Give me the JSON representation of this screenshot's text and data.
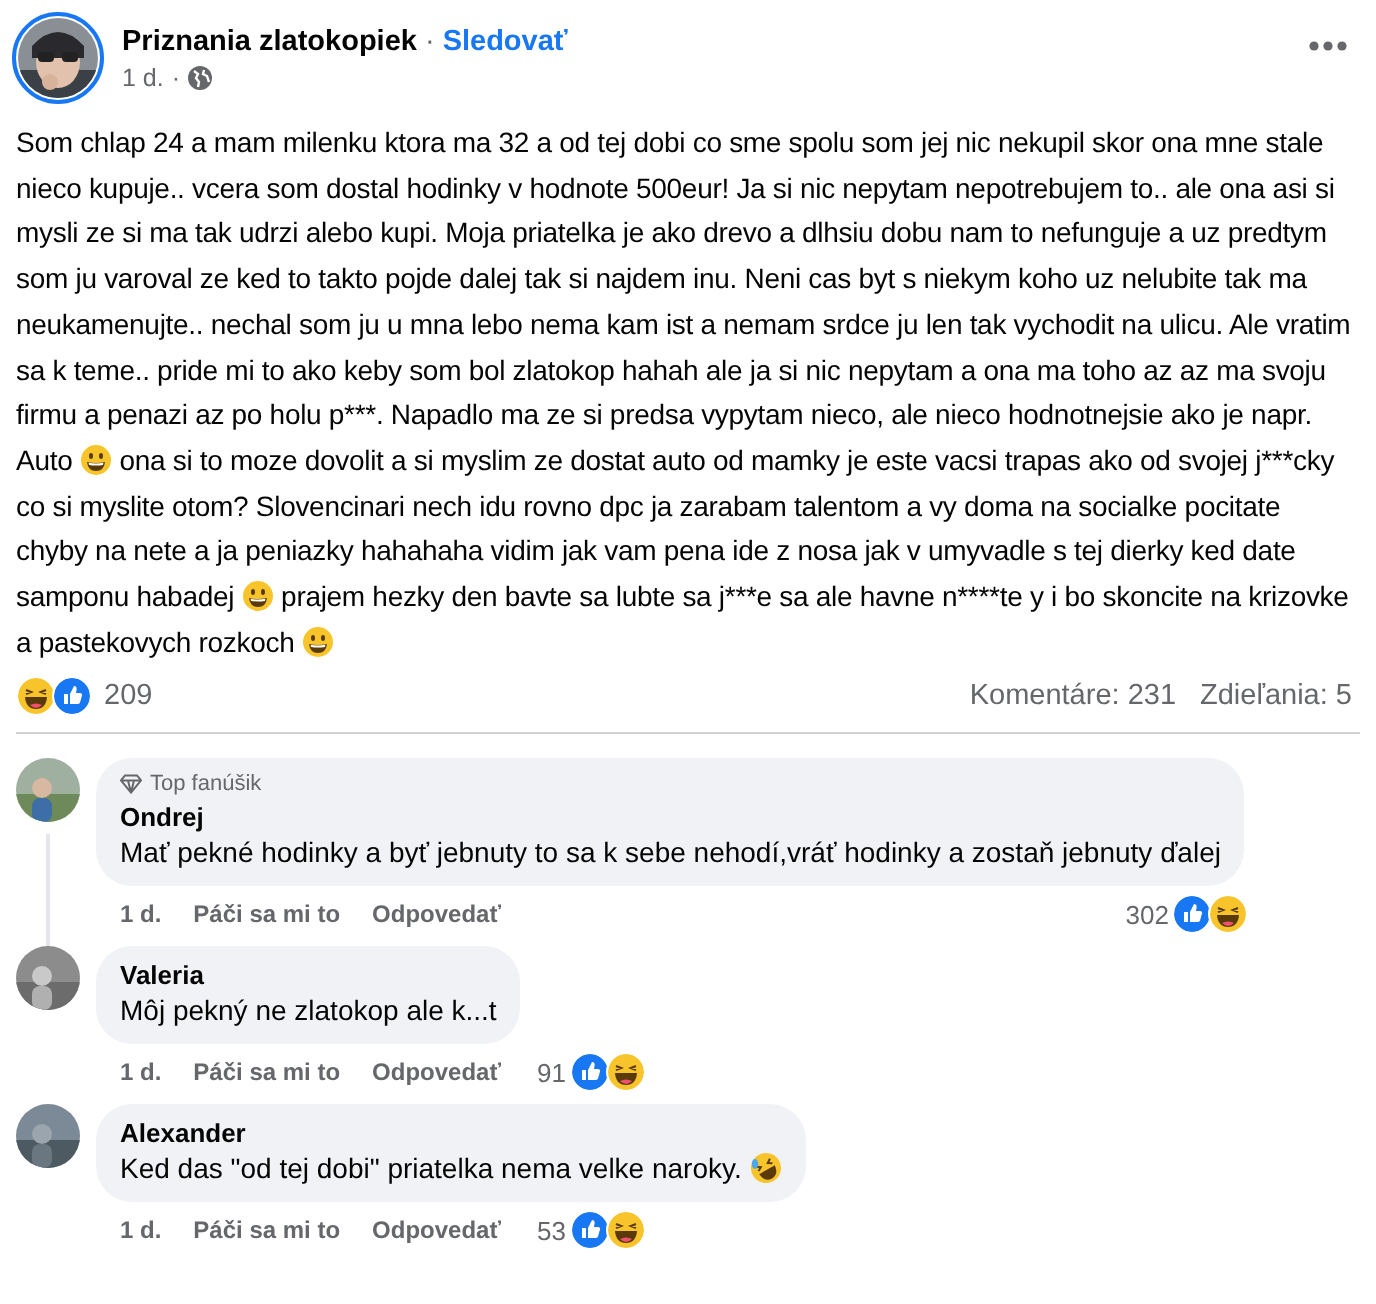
{
  "post": {
    "page_name": "Priznania zlatokopiek",
    "separator": "·",
    "follow": "Sledovať",
    "time": "1 d.",
    "time_separator": "·",
    "body": [
      {
        "kind": "text",
        "text": "Som chlap 24 a mam milenku ktora ma 32 a od tej dobi co sme spolu som jej nic nekupil skor ona mne stale nieco kupuje.. vcera som dostal hodinky v hodnote 500eur! Ja si nic nepytam nepotrebujem to.. ale ona asi si mysli ze si ma tak udrzi alebo kupi. Moja priatelka je ako drevo a dlhsiu dobu nam to nefunguje a uz predtym som ju varoval ze ked to takto pojde dalej tak si najdem inu. Neni cas byt s niekym koho uz nelubite tak ma neukamenujte.. nechal som ju u mna lebo nema kam ist a nemam srdce ju len tak vychodit na ulicu. Ale vratim sa k teme.. pride mi to ako keby som bol zlatokop hahah ale ja si nic nepytam a ona ma toho az az ma svoju firmu a penazi az po holu p***. Napadlo ma ze si predsa vypytam nieco, ale nieco hodnotnejsie ako je napr. Auto "
      },
      {
        "kind": "grin"
      },
      {
        "kind": "text",
        "text": " ona si to moze dovolit a si myslim ze dostat auto od mamky je este vacsi trapas ako od svojej j***cky co si myslite otom? Slovencinari nech idu rovno dpc ja zarabam talentom a vy doma na socialke pocitate chyby na nete a ja peniazky hahahaha vidim jak vam pena ide z nosa jak v umyvadle s tej dierky ked date samponu habadej "
      },
      {
        "kind": "grin"
      },
      {
        "kind": "text",
        "text": " prajem hezky den bavte sa lubte sa j***e sa ale havne n****te y i bo skoncite na krizovke a pastekovych rozkoch "
      },
      {
        "kind": "grin"
      }
    ],
    "reactions": [
      {
        "kind": "haha"
      },
      {
        "kind": "like"
      }
    ],
    "reaction_count": "209",
    "comments_count": "Komentáre: 231",
    "shares_count": "Zdieľania: 5"
  },
  "comments": [
    {
      "badge": "Top fanúšik",
      "author": "Ondrej",
      "body": [
        {
          "kind": "text",
          "text": "Mať pekné hodinky a byť jebnuty to sa k sebe nehodí,vráť hodinky a zostaň jebnuty ďalej"
        }
      ],
      "time": "1 d.",
      "like": "Páči sa mi to",
      "reply": "Odpovedať",
      "count": "302",
      "reactions": [
        {
          "kind": "like"
        },
        {
          "kind": "haha"
        }
      ],
      "thread": true
    },
    {
      "author": "Valeria",
      "body": [
        {
          "kind": "text",
          "text": "Môj pekný ne zlatokop ale k...t"
        }
      ],
      "time": "1 d.",
      "like": "Páči sa mi to",
      "reply": "Odpovedať",
      "count": "91",
      "reactions": [
        {
          "kind": "like"
        },
        {
          "kind": "haha"
        }
      ],
      "thread": false
    },
    {
      "author": "Alexander",
      "body": [
        {
          "kind": "text",
          "text": "Ked das \"od tej dobi\" priatelka nema velke naroky. "
        },
        {
          "kind": "rofl"
        }
      ],
      "time": "1 d.",
      "like": "Páči sa mi to",
      "reply": "Odpovedať",
      "count": "53",
      "reactions": [
        {
          "kind": "like"
        },
        {
          "kind": "haha"
        }
      ],
      "thread": false
    }
  ]
}
